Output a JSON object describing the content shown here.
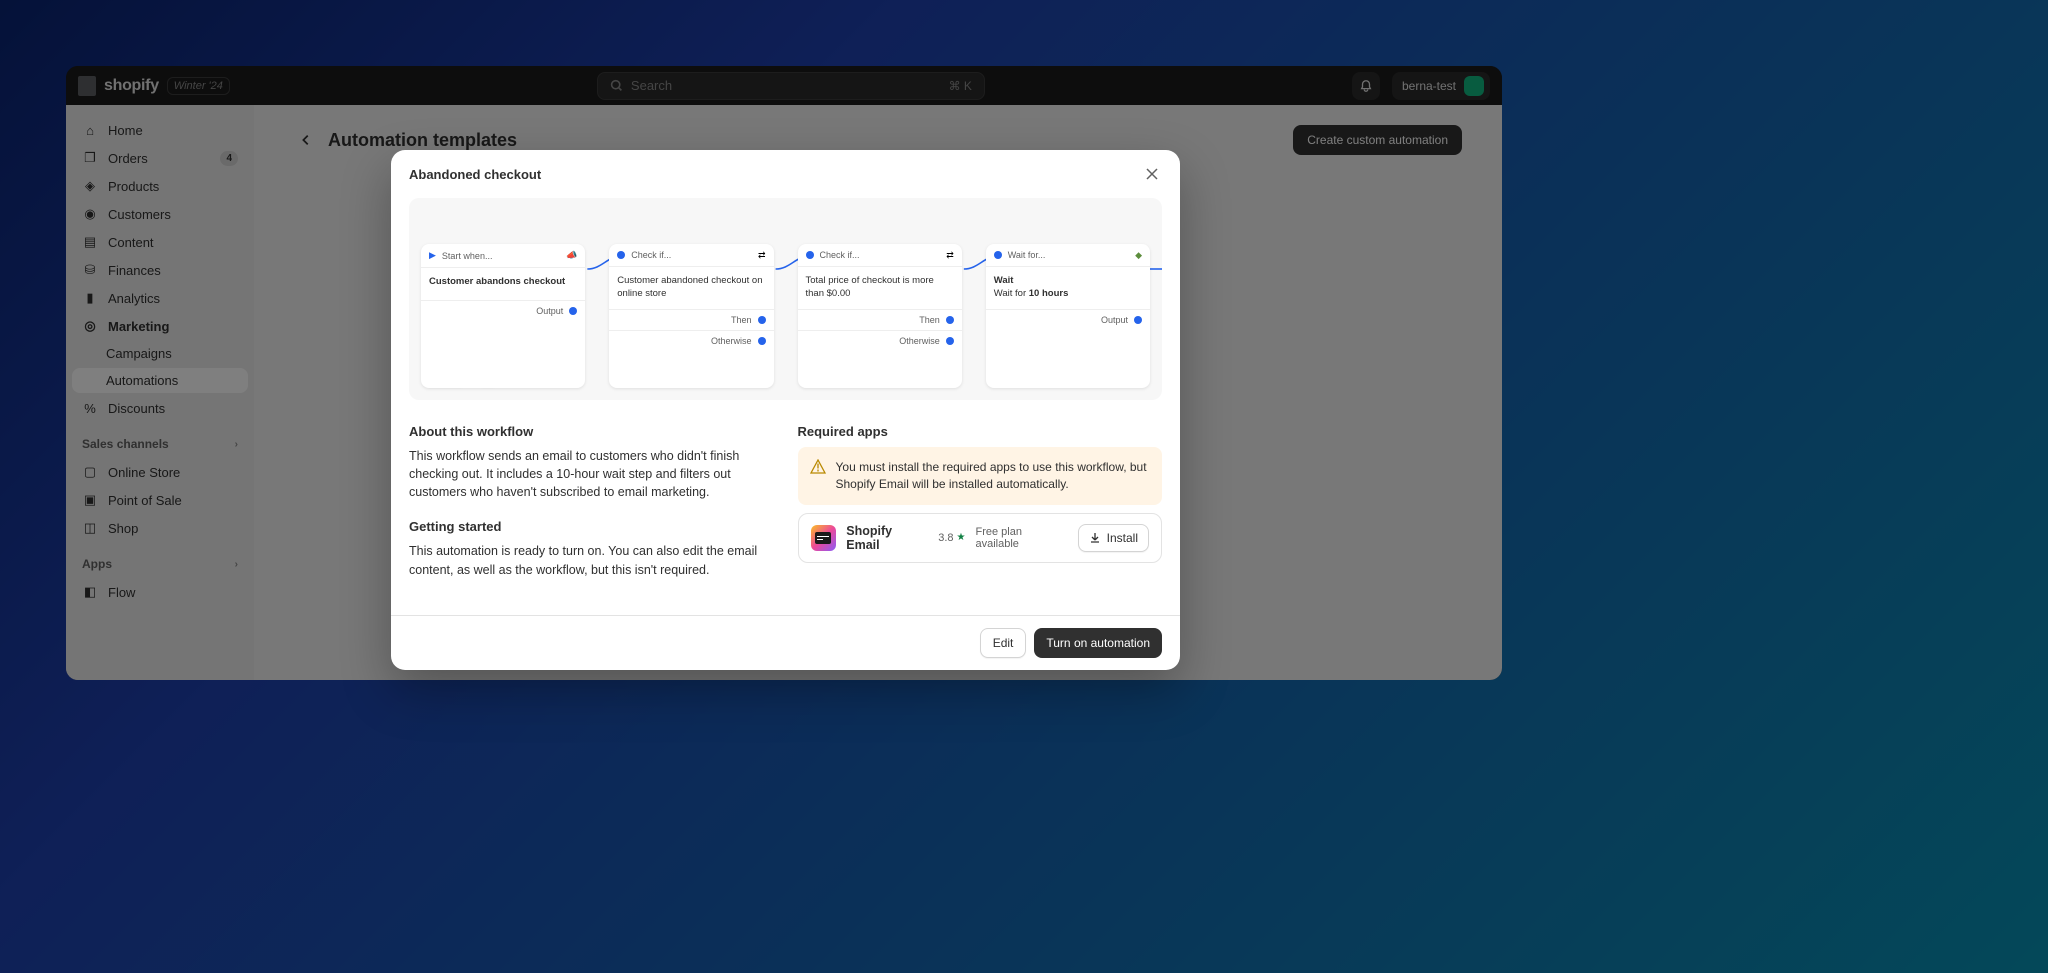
{
  "topbar": {
    "brand": "shopify",
    "badge": "Winter '24",
    "search_placeholder": "Search",
    "search_shortcut": "⌘ K",
    "user": "berna-test"
  },
  "sidebar": {
    "items": [
      {
        "label": "Home"
      },
      {
        "label": "Orders",
        "badge": "4"
      },
      {
        "label": "Products"
      },
      {
        "label": "Customers"
      },
      {
        "label": "Content"
      },
      {
        "label": "Finances"
      },
      {
        "label": "Analytics"
      },
      {
        "label": "Marketing"
      }
    ],
    "marketing_sub": [
      {
        "label": "Campaigns"
      },
      {
        "label": "Automations"
      }
    ],
    "discounts": "Discounts",
    "section_channels": "Sales channels",
    "channels": [
      {
        "label": "Online Store"
      },
      {
        "label": "Point of Sale"
      },
      {
        "label": "Shop"
      }
    ],
    "section_apps": "Apps",
    "apps": [
      {
        "label": "Flow"
      }
    ]
  },
  "page": {
    "title": "Automation templates",
    "create_btn": "Create custom automation"
  },
  "modal": {
    "title": "Abandoned checkout",
    "workflow": {
      "start": {
        "header": "Start when...",
        "body": "Customer abandons checkout",
        "foot": "Output"
      },
      "check1": {
        "header": "Check if...",
        "body": "Customer abandoned checkout on online store",
        "then": "Then",
        "otherwise": "Otherwise"
      },
      "check2": {
        "header": "Check if...",
        "body": "Total price of checkout is more than $0.00",
        "then": "Then",
        "otherwise": "Otherwise"
      },
      "wait": {
        "header": "Wait for...",
        "body_label": "Wait",
        "body_text": "Wait for ",
        "body_bold": "10 hours",
        "foot": "Output"
      }
    },
    "about": {
      "h": "About this workflow",
      "p": "This workflow sends an email to customers who didn't finish checking out. It includes a 10-hour wait step and filters out customers who haven't subscribed to email marketing."
    },
    "getting": {
      "h": "Getting started",
      "p": "This automation is ready to turn on. You can also edit the email content, as well as the workflow, but this isn't required."
    },
    "required": {
      "h": "Required apps",
      "warning": "You must install the required apps to use this workflow, but Shopify Email will be installed automatically.",
      "app": {
        "name": "Shopify Email",
        "rating": "3.8",
        "plan": "Free plan available",
        "install": "Install"
      }
    },
    "footer": {
      "edit": "Edit",
      "turn_on": "Turn on automation"
    }
  }
}
